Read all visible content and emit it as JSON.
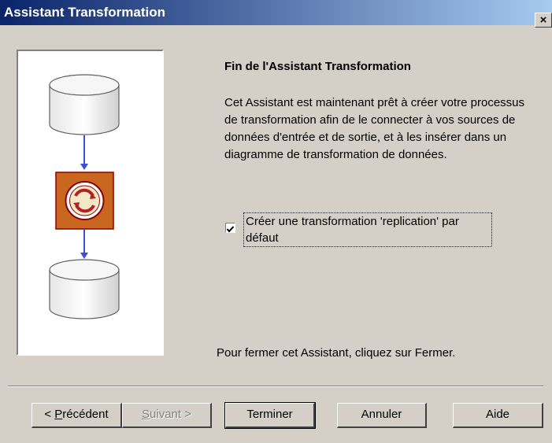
{
  "window": {
    "title": "Assistant Transformation",
    "close_symbol": "×"
  },
  "content": {
    "heading": "Fin de l'Assistant Transformation",
    "paragraph": "Cet Assistant est maintenant prêt à créer votre processus de transformation afin de le connecter à vos sources de données d'entrée et de sortie, et à les insérer dans un diagramme de transformation de données.",
    "checkbox": {
      "label": "Créer une transformation 'replication' par défaut",
      "checked": true
    },
    "close_note": "Pour fermer cet Assistant, cliquez sur Fermer."
  },
  "buttons": {
    "previous": {
      "prefix": "< ",
      "mnemonic": "P",
      "rest": "récédent"
    },
    "next": {
      "mnemonic": "S",
      "rest": "uivant >"
    },
    "finish": "Terminer",
    "cancel": "Annuler",
    "help": "Aide"
  },
  "colors": {
    "title_start": "#0a246a",
    "title_end": "#a6caf0",
    "dialog_bg": "#d4d0c8",
    "transform_fill": "#c9661f",
    "transform_border": "#8b0000",
    "arrow": "#3a4fd8"
  },
  "icons": [
    "source-database-icon",
    "transformation-process-icon",
    "target-database-icon",
    "down-arrow-icon"
  ]
}
